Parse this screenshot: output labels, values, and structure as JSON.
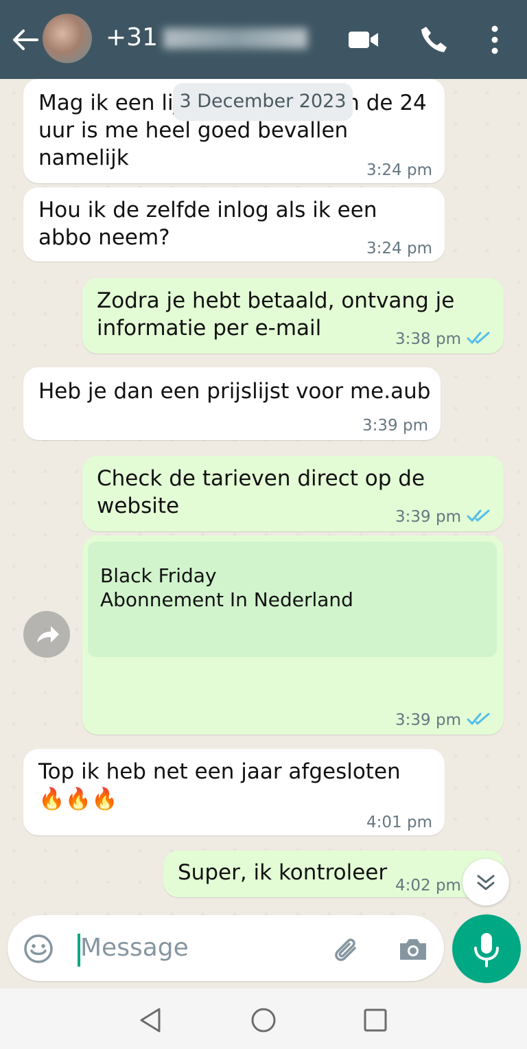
{
  "header": {
    "contact_prefix": "+31",
    "icons": [
      "back-arrow-icon",
      "video-call-icon",
      "voice-call-icon",
      "more-options-icon"
    ]
  },
  "date_separator": "3 December 2023",
  "messages": [
    {
      "direction": "incoming",
      "text": "Mag ik een lijst met de prijzen de 24\nuur is me heel goed bevallen\nnamelijk",
      "time": "3:24 pm"
    },
    {
      "direction": "incoming",
      "text": "Hou ik de zelfde inlog als ik een\nabbo neem?",
      "time": "3:24 pm"
    },
    {
      "direction": "outgoing",
      "text": "Zodra je hebt betaald, ontvang je\ninformatie per e-mail",
      "time": "3:38 pm",
      "status": "read"
    },
    {
      "direction": "incoming",
      "text": "Heb je dan een prijslijst voor me.aub",
      "time": "3:39 pm"
    },
    {
      "direction": "outgoing",
      "text": "Check de tarieven direct op de\nwebsite",
      "time": "3:39 pm",
      "status": "read"
    },
    {
      "direction": "outgoing",
      "link_preview_title": "Black Friday\nAbonnement In Nederland",
      "time": "3:39 pm",
      "status": "read"
    },
    {
      "direction": "incoming",
      "text": "Top ik heb net een jaar afgesloten\n🔥🔥🔥",
      "time": "4:01 pm"
    },
    {
      "direction": "outgoing",
      "text": "Super, ik kontroleer",
      "time": "4:02 pm",
      "status": "read"
    }
  ],
  "input": {
    "placeholder": "Message"
  },
  "colors": {
    "header": "#3e5663",
    "outgoing_bubble": "#e3fcd5",
    "accent": "#00a884",
    "read_ticks": "#53bdeb"
  }
}
